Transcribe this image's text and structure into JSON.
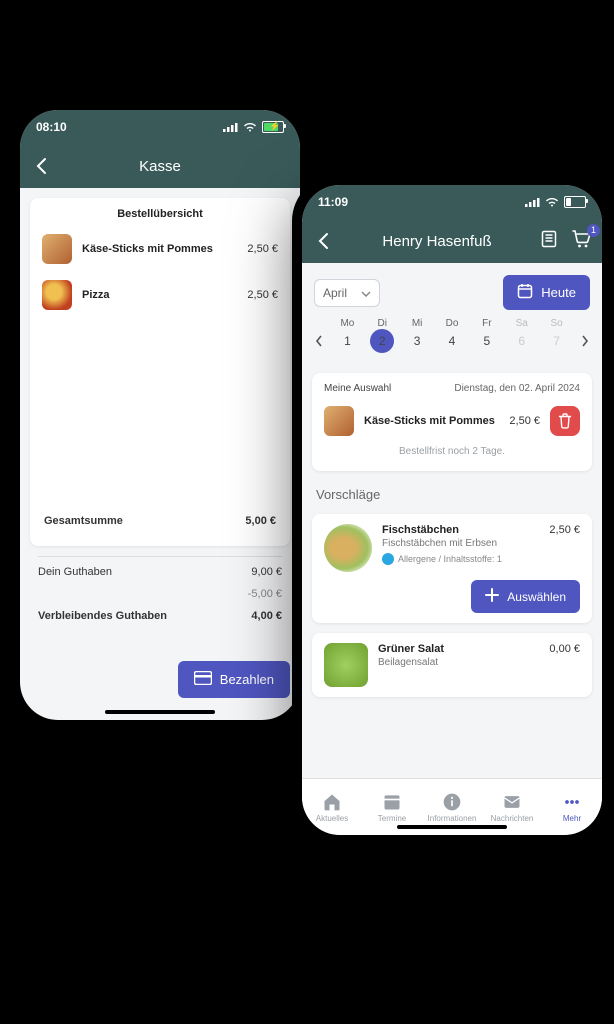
{
  "left": {
    "status_time": "08:10",
    "title": "Kasse",
    "overview_label": "Bestellübersicht",
    "items": [
      {
        "name": "Käse-Sticks mit Pommes",
        "price": "2,50 €"
      },
      {
        "name": "Pizza",
        "price": "2,50 €"
      }
    ],
    "total_label": "Gesamtsumme",
    "total_value": "5,00 €",
    "credit_label": "Dein Guthaben",
    "credit_value": "9,00 €",
    "credit_delta": "-5,00 €",
    "remaining_label": "Verbleibendes Guthaben",
    "remaining_value": "4,00 €",
    "pay_label": "Bezahlen"
  },
  "right": {
    "status_time": "11:09",
    "title": "Henry Hasenfuß",
    "cart_count": "1",
    "month": "April",
    "today_label": "Heute",
    "weekdays": [
      "Mo",
      "Di",
      "Mi",
      "Do",
      "Fr",
      "Sa",
      "So"
    ],
    "daynums": [
      "1",
      "2",
      "3",
      "4",
      "5",
      "6",
      "7"
    ],
    "selected_index": 1,
    "selection_label": "Meine Auswahl",
    "selection_date": "Dienstag, den 02. April 2024",
    "sel_item": {
      "name": "Käse-Sticks mit Pommes",
      "price": "2,50 €"
    },
    "deadline": "Bestellfrist noch 2 Tage.",
    "suggestions_label": "Vorschläge",
    "sugg1": {
      "name": "Fischstäbchen",
      "sub": "Fischstäbchen mit Erbsen",
      "allergen": "Allergene / Inhaltsstoffe: 1",
      "price": "2,50 €"
    },
    "sugg2": {
      "name": "Grüner Salat",
      "sub": "Beilagensalat",
      "price": "0,00 €"
    },
    "select_label": "Auswählen",
    "tabs": {
      "aktuelles": "Aktuelles",
      "termine": "Termine",
      "informationen": "Informationen",
      "nachrichten": "Nachrichten",
      "mehr": "Mehr"
    }
  }
}
